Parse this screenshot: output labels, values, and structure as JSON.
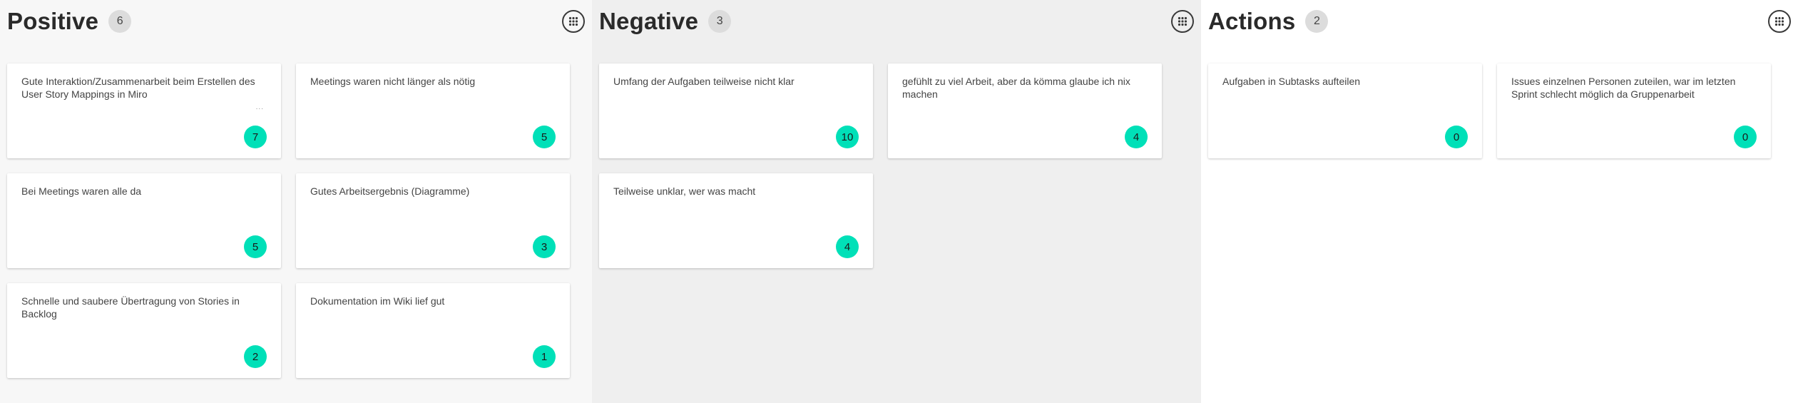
{
  "columns": [
    {
      "title": "Positive",
      "count": "6",
      "cards": [
        {
          "text": "Gute Interaktion/Zusammenarbeit beim Erstellen des User Story Mappings in Miro",
          "votes": "7",
          "ellipsis": "..."
        },
        {
          "text": "Meetings waren nicht länger als nötig",
          "votes": "5"
        },
        {
          "text": "Bei Meetings waren alle da",
          "votes": "5"
        },
        {
          "text": "Gutes Arbeitsergebnis (Diagramme)",
          "votes": "3"
        },
        {
          "text": "Schnelle und saubere Übertragung von Stories in Backlog",
          "votes": "2"
        },
        {
          "text": "Dokumentation im Wiki lief gut",
          "votes": "1"
        }
      ]
    },
    {
      "title": "Negative",
      "count": "3",
      "cards": [
        {
          "text": "Umfang der Aufgaben teilweise nicht klar",
          "votes": "10"
        },
        {
          "text": "gefühlt zu viel Arbeit, aber da kömma glaube ich nix machen",
          "votes": "4"
        },
        {
          "text": "Teilweise unklar, wer was macht",
          "votes": "4"
        }
      ]
    },
    {
      "title": "Actions",
      "count": "2",
      "cards": [
        {
          "text": "Aufgaben in Subtasks aufteilen",
          "votes": "0"
        },
        {
          "text": "Issues einzelnen Personen zuteilen, war im letzten Sprint schlecht möglich da Gruppenarbeit",
          "votes": "0"
        }
      ]
    }
  ],
  "icons": {
    "menu": "grid-menu-icon"
  },
  "colors": {
    "vote_badge": "#00e0b8",
    "count_badge": "#dcdcdc"
  }
}
